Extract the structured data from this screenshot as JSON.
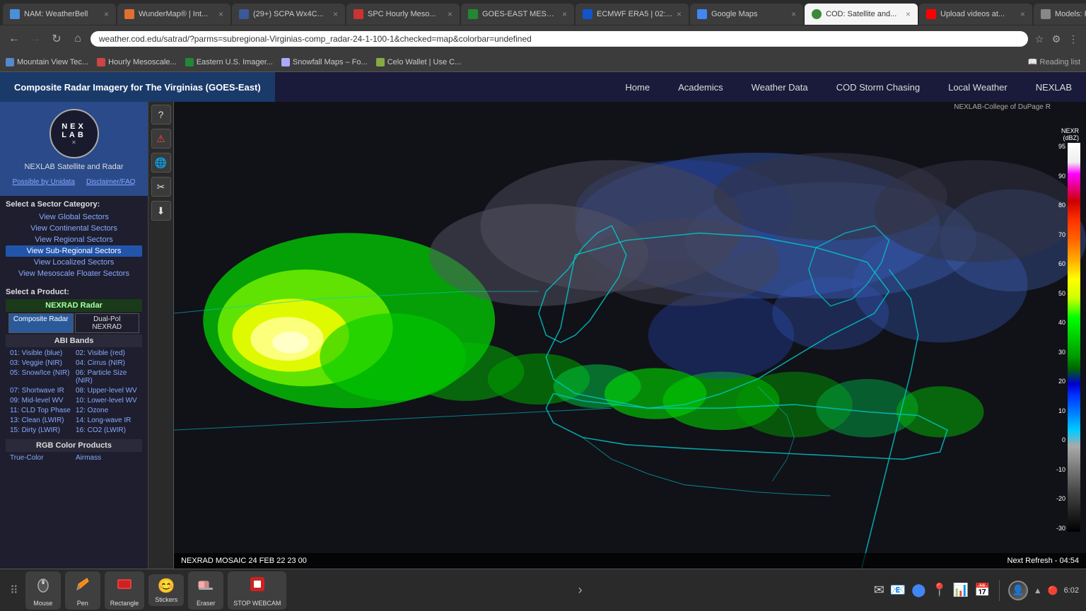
{
  "browser": {
    "tabs": [
      {
        "id": "tab1",
        "label": "NAM: WeatherBell",
        "active": false,
        "favicon": "🌤"
      },
      {
        "id": "tab2",
        "label": "WunderMap® | Int...",
        "active": false,
        "favicon": "🗺"
      },
      {
        "id": "tab3",
        "label": "(29+) SCPA Wx4C...",
        "active": false,
        "favicon": "f"
      },
      {
        "id": "tab4",
        "label": "SPC Hourly Meso...",
        "active": false,
        "favicon": "🌩"
      },
      {
        "id": "tab5",
        "label": "GOES-EAST MESO...",
        "active": false,
        "favicon": "🛰"
      },
      {
        "id": "tab6",
        "label": "ECMWF ERA5 | 02:...",
        "active": false,
        "favicon": "E"
      },
      {
        "id": "tab7",
        "label": "Google Maps",
        "active": false,
        "favicon": "📍"
      },
      {
        "id": "tab8",
        "label": "COD: Satellite and...",
        "active": true,
        "favicon": "🌍"
      },
      {
        "id": "tab9",
        "label": "Upload videos at...",
        "active": false,
        "favicon": "▶"
      },
      {
        "id": "tab10",
        "label": "Models: RAP – Pi...",
        "active": false,
        "favicon": "📊"
      }
    ],
    "address": "weather.cod.edu/satrad/?parms=subregional-Virginias-comp_radar-24-1-100-1&checked=map&colorbar=undefined",
    "bookmarks": [
      {
        "label": "Mountain View Tec...",
        "favicon": "🏔"
      },
      {
        "label": "Hourly Mesoscale...",
        "favicon": "🌡"
      },
      {
        "label": "Eastern U.S. Imager...",
        "favicon": "🛰"
      },
      {
        "label": "Snowfall Maps – Fo...",
        "favicon": "❄"
      },
      {
        "label": "Celo Wallet | Use C...",
        "favicon": "💰"
      }
    ]
  },
  "site": {
    "title": "Composite Radar Imagery for The Virginias (GOES-East)",
    "nav": {
      "home": "Home",
      "academics": "Academics",
      "weather_data": "Weather Data",
      "storm_chasing": "COD Storm Chasing",
      "local_weather": "Local Weather",
      "nexlab": "NEXLAB"
    }
  },
  "sidebar": {
    "logo_text": "NEX  LAB",
    "title": "NEXLAB Satellite and Radar",
    "link1": "Possible by Unidata",
    "link2": "Disclaimer/FAQ",
    "sector_title": "Select a Sector Category:",
    "sectors": [
      "View Global Sectors",
      "View Continental Sectors",
      "View Regional Sectors",
      "View Sub-Regional Sectors",
      "View Localized Sectors",
      "View Mesoscale Floater Sectors"
    ],
    "product_title": "Select a Product:",
    "nexrad_header": "NEXRAD Radar",
    "radar_tabs": [
      "Composite Radar",
      "Dual-Pol NEXRAD"
    ],
    "abi_header": "ABI Bands",
    "abi_items": [
      "01: Visible (blue)",
      "02: Visible (red)",
      "03: Veggie (NIR)",
      "04: Cirrus (NIR)",
      "05: Snow/Ice (NIR)",
      "06: Particle Size (NIR)",
      "07: Shortwave IR",
      "08: Upper-level WV",
      "09: Mid-level WV",
      "10: Lower-level WV",
      "11: CLD Top Phase",
      "12: Ozone",
      "13: Clean (LWIR)",
      "14: Long-wave IR",
      "15: Dirty (LWIR)",
      "16: CO2 (LWIR)"
    ],
    "rgb_header": "RGB Color Products",
    "rgb_items": [
      "True-Color",
      "Airmass"
    ]
  },
  "colorbar": {
    "title": "NEXR",
    "unit": "(dBZ)",
    "ticks": [
      "95",
      "90",
      "80",
      "70",
      "60",
      "50",
      "40",
      "30",
      "20",
      "10",
      "0",
      "-10",
      "-20",
      "-30"
    ]
  },
  "status": {
    "nexrad_info": "NEXRAD MOSAIC  24 FEB 22  23 00",
    "next_refresh": "Next Refresh - 04:54"
  },
  "watermark": "NEXLAB-College of DuPage R",
  "taskbar": {
    "items": [
      {
        "label": "Mouse",
        "icon": "🖱"
      },
      {
        "label": "Pen",
        "icon": "✏️"
      },
      {
        "label": "Rectangle",
        "icon": "⬜"
      },
      {
        "label": "Stickers",
        "icon": "😊"
      },
      {
        "label": "Eraser",
        "icon": "🧹"
      },
      {
        "label": "STOP WEBCAM",
        "icon": "🔴"
      }
    ]
  },
  "tray": {
    "time": "6:02"
  }
}
